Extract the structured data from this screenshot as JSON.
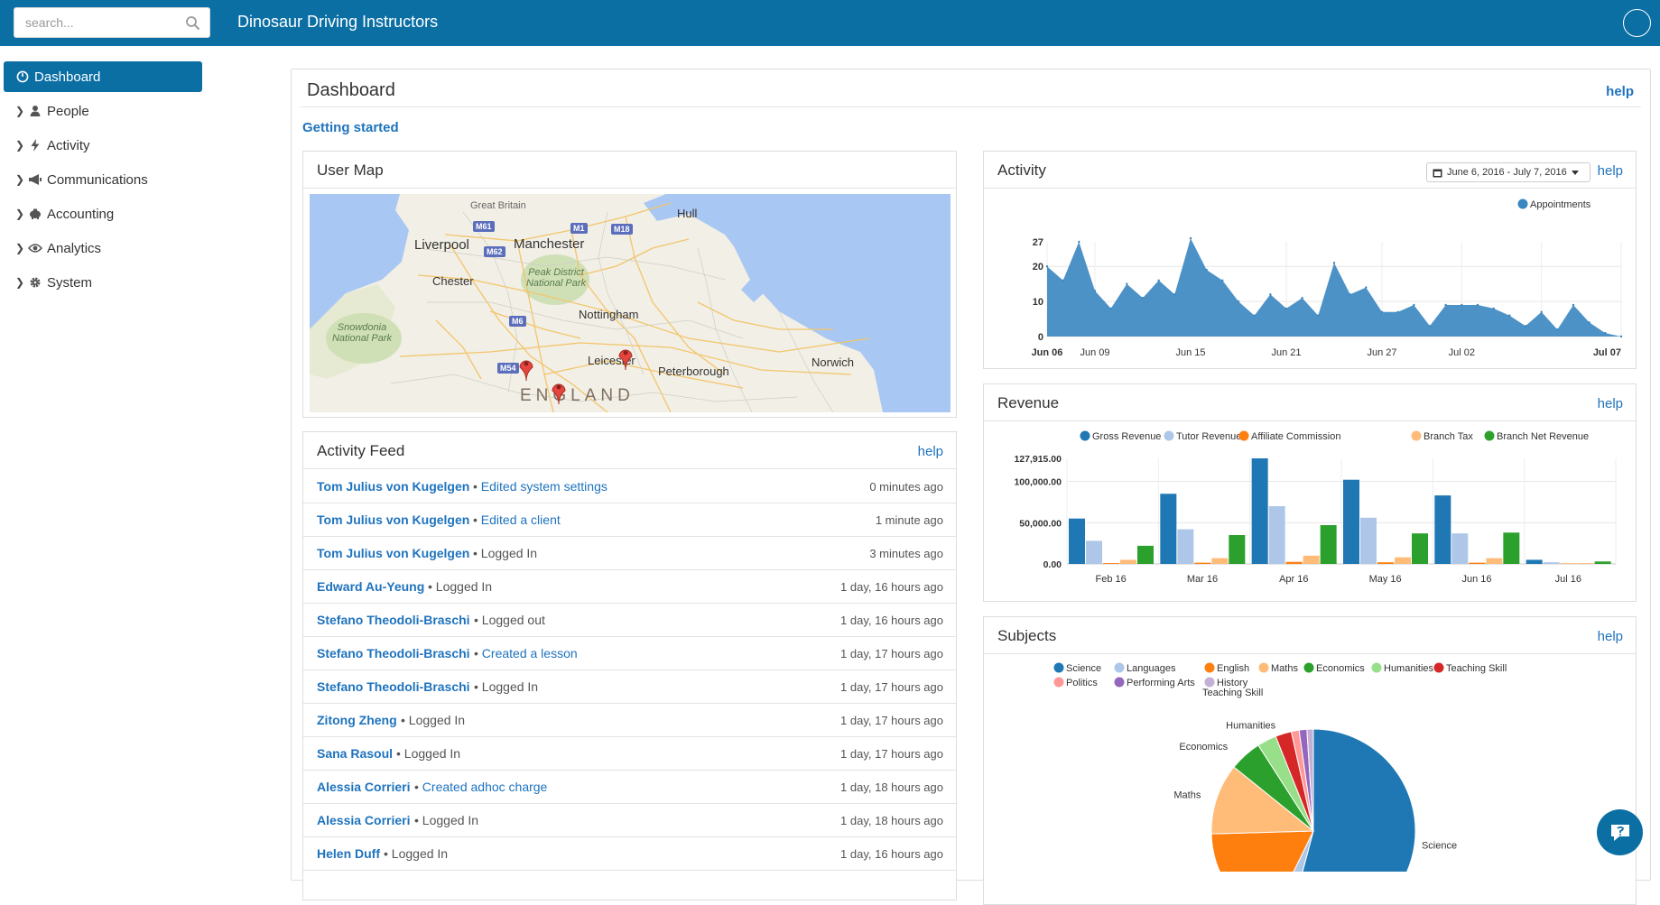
{
  "app": {
    "title": "Dinosaur Driving Instructors"
  },
  "search": {
    "placeholder": "search..."
  },
  "sidebar": {
    "items": [
      {
        "label": "Dashboard",
        "icon": "dashboard-icon",
        "active": true
      },
      {
        "label": "People",
        "icon": "person-icon"
      },
      {
        "label": "Activity",
        "icon": "lightning-icon"
      },
      {
        "label": "Communications",
        "icon": "megaphone-icon"
      },
      {
        "label": "Accounting",
        "icon": "piggy-bank-icon"
      },
      {
        "label": "Analytics",
        "icon": "eye-icon"
      },
      {
        "label": "System",
        "icon": "gear-icon"
      }
    ]
  },
  "dashboard": {
    "title": "Dashboard",
    "help": "help",
    "getting_started": "Getting started"
  },
  "user_map": {
    "title": "User Map",
    "labels": {
      "great_britain": "Great Britain",
      "hull": "Hull",
      "liverpool": "Liverpool",
      "manchester": "Manchester",
      "chester": "Chester",
      "peak_district": "Peak District National Park",
      "nottingham": "Nottingham",
      "snowdonia": "Snowdonia National Park",
      "leicester": "Leicester",
      "peterborough": "Peterborough",
      "norwich": "Norwich",
      "england": "ENGLAND"
    },
    "roads": {
      "m61": "M61",
      "m1": "M1",
      "m18": "M18",
      "m62": "M62",
      "m6": "M6",
      "m54": "M54"
    },
    "pin_count": 3
  },
  "activity_feed": {
    "title": "Activity Feed",
    "help": "help",
    "rows": [
      {
        "name": "Tom Julius von Kugelgen",
        "sep": "•",
        "action": "Edited system settings",
        "action_link": true,
        "time": "0 minutes ago"
      },
      {
        "name": "Tom Julius von Kugelgen",
        "sep": "•",
        "action": "Edited a client",
        "action_link": true,
        "time": "1 minute ago"
      },
      {
        "name": "Tom Julius von Kugelgen",
        "sep": "•",
        "action": "Logged In",
        "action_link": false,
        "time": "3 minutes ago"
      },
      {
        "name": "Edward Au-Yeung",
        "sep": "•",
        "action": "Logged In",
        "action_link": false,
        "time": "1 day, 16 hours ago"
      },
      {
        "name": "Stefano Theodoli-Braschi",
        "sep": "•",
        "action": "Logged out",
        "action_link": false,
        "time": "1 day, 16 hours ago"
      },
      {
        "name": "Stefano Theodoli-Braschi",
        "sep": "•",
        "action": "Created a lesson",
        "action_link": true,
        "time": "1 day, 17 hours ago"
      },
      {
        "name": "Stefano Theodoli-Braschi",
        "sep": "•",
        "action": "Logged In",
        "action_link": false,
        "time": "1 day, 17 hours ago"
      },
      {
        "name": "Zitong Zheng",
        "sep": "•",
        "action": "Logged In",
        "action_link": false,
        "time": "1 day, 17 hours ago"
      },
      {
        "name": "Sana Rasoul",
        "sep": "•",
        "action": "Logged In",
        "action_link": false,
        "time": "1 day, 17 hours ago"
      },
      {
        "name": "Alessia Corrieri",
        "sep": "•",
        "action": "Created adhoc charge",
        "action_link": true,
        "time": "1 day, 18 hours ago"
      },
      {
        "name": "Alessia Corrieri",
        "sep": "•",
        "action": "Logged In",
        "action_link": false,
        "time": "1 day, 18 hours ago"
      },
      {
        "name": "Helen Duff",
        "sep": "•",
        "action": "Logged In",
        "action_link": false,
        "time": "1 day, 16 hours ago"
      }
    ]
  },
  "activity": {
    "title": "Activity",
    "help": "help",
    "date_range": "June 6, 2016 - July 7, 2016"
  },
  "revenue": {
    "title": "Revenue",
    "help": "help"
  },
  "subjects": {
    "title": "Subjects",
    "help": "help"
  },
  "colors": {
    "brand": "#0b6fa4",
    "link": "#1e73be"
  },
  "chart_data": [
    {
      "type": "area",
      "series": [
        {
          "name": "Appointments",
          "color": "#3a86c0",
          "values": [
            20,
            16,
            27,
            13,
            8,
            15,
            11,
            16,
            12,
            28,
            19,
            16,
            10,
            6,
            12,
            8,
            11,
            6,
            21,
            12,
            14,
            7,
            7,
            9,
            3,
            9,
            9,
            9,
            8,
            6,
            3,
            7,
            2,
            9,
            4,
            1,
            0
          ]
        }
      ],
      "x_tick_labels": [
        "Jun 06",
        "Jun 09",
        "Jun 15",
        "Jun 21",
        "Jun 27",
        "Jul 02",
        "Jul 07"
      ],
      "y_ticks": [
        0,
        10,
        20,
        27
      ],
      "ylim": [
        0,
        27
      ],
      "legend": "top-right"
    },
    {
      "type": "bar",
      "categories": [
        "Feb 16",
        "Mar 16",
        "Apr 16",
        "May 16",
        "Jun 16",
        "Jul 16"
      ],
      "series": [
        {
          "name": "Gross Revenue",
          "color": "#1f77b4",
          "values": [
            55000,
            85000,
            127915,
            102000,
            83000,
            5000
          ]
        },
        {
          "name": "Tutor Revenue",
          "color": "#aec7e8",
          "values": [
            28000,
            42000,
            70000,
            56000,
            37000,
            2000
          ]
        },
        {
          "name": "Affiliate Commission",
          "color": "#ff7f0e",
          "values": [
            1000,
            1500,
            2500,
            2000,
            1500,
            500
          ]
        },
        {
          "name": "Branch Tax",
          "color": "#ffbb78",
          "values": [
            5000,
            7000,
            10000,
            8000,
            7000,
            1000
          ]
        },
        {
          "name": "Branch Net Revenue",
          "color": "#2ca02c",
          "values": [
            22000,
            35000,
            47000,
            37000,
            38000,
            3000
          ]
        }
      ],
      "y_tick_labels": [
        "0.00",
        "50,000.00",
        "100,000.00",
        "127,915.00"
      ],
      "ylim": [
        0,
        127915
      ],
      "legend": "top"
    },
    {
      "type": "pie",
      "slices": [
        {
          "name": "Science",
          "color": "#1f77b4",
          "value": 53
        },
        {
          "name": "Languages",
          "color": "#aec7e8",
          "value": 3
        },
        {
          "name": "English",
          "color": "#ff7f0e",
          "value": 17
        },
        {
          "name": "Maths",
          "color": "#ffbb78",
          "value": 11
        },
        {
          "name": "Economics",
          "color": "#2ca02c",
          "value": 5
        },
        {
          "name": "Humanities",
          "color": "#98df8a",
          "value": 3
        },
        {
          "name": "Teaching Skill",
          "color": "#d62728",
          "value": 2.5
        },
        {
          "name": "Politics",
          "color": "#ff9896",
          "value": 1.2
        },
        {
          "name": "Performing Arts",
          "color": "#9467bd",
          "value": 1.2
        },
        {
          "name": "History",
          "color": "#c5b0d5",
          "value": 1
        }
      ],
      "legend_rows": [
        [
          "Science",
          "Languages",
          "English",
          "Maths",
          "Economics",
          "Humanities",
          "Teaching Skill"
        ],
        [
          "Politics",
          "Performing Arts",
          "History"
        ]
      ],
      "legend_extra": "Teaching Skill",
      "slice_labels": [
        "Science",
        "Maths",
        "Economics",
        "Humanities",
        "English"
      ],
      "legend": "top"
    }
  ]
}
